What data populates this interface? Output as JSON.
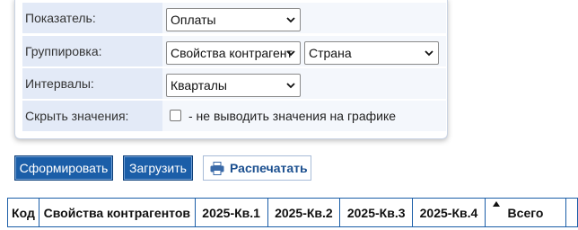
{
  "form": {
    "indicator": {
      "label": "Показатель:",
      "value": "Оплаты"
    },
    "grouping": {
      "label": "Группировка:",
      "value1": "Свойства контрагент",
      "value2": "Страна"
    },
    "intervals": {
      "label": "Интервалы:",
      "value": "Кварталы"
    },
    "hide_values": {
      "label": "Скрыть значения:",
      "checkbox_label": "- не выводить значения на графике",
      "checked": false
    }
  },
  "buttons": {
    "generate": "Сформировать",
    "load": "Загрузить",
    "print": "Распечатать"
  },
  "table": {
    "headers": [
      "Код",
      "Свойства контрагентов",
      "2025-Кв.1",
      "2025-Кв.2",
      "2025-Кв.3",
      "2025-Кв.4",
      "Всего",
      ""
    ]
  },
  "colors": {
    "accent": "#1b5ea8",
    "label_bg": "#e3eaf7"
  },
  "icons": {
    "select_arrow": "chevron-down-icon",
    "print": "printer-icon",
    "sort": "sort-up-icon"
  }
}
